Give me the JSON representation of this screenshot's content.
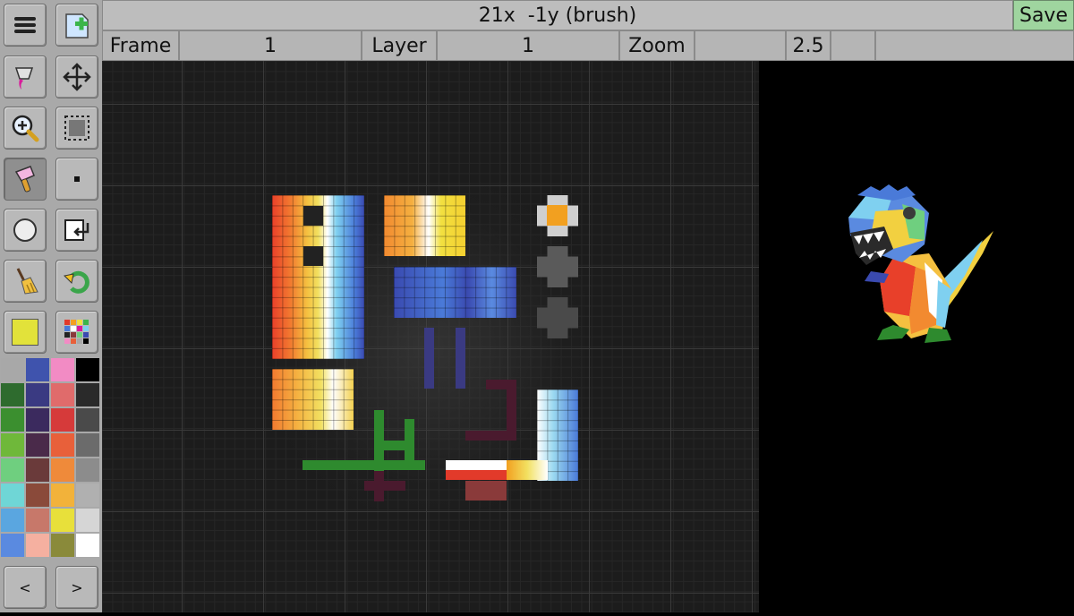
{
  "titlebar": {
    "text": "21x  -1y (brush)"
  },
  "save_label": "Save",
  "infobar": {
    "frame_label": "Frame",
    "frame_value": "1",
    "layer_label": "Layer",
    "layer_value": "1",
    "zoom_label": "Zoom",
    "zoom_value": "2.5"
  },
  "current_color": "#e2e23a",
  "palette": [
    "#a8a8a8",
    "#3f53ad",
    "#f28bc4",
    "#000000",
    "#2e6b2e",
    "#3a3a82",
    "#e06b6b",
    "#2a2a2a",
    "#3b8f2f",
    "#3b2a5e",
    "#d63a3a",
    "#4a4a4a",
    "#6fb83a",
    "#4a2a4a",
    "#e8603a",
    "#6b6b6b",
    "#6fcf7f",
    "#6a3a3a",
    "#ef8a3a",
    "#8c8c8c",
    "#6fd6d6",
    "#8a4a3a",
    "#f2b23a",
    "#b0b0b0",
    "#5aa6e0",
    "#c7786a",
    "#e8e03a",
    "#d6d6d6",
    "#5a8ae0",
    "#f5b0a0",
    "#8a8a3a",
    "#ffffff"
  ],
  "nav": {
    "prev": "<",
    "next": ">"
  }
}
